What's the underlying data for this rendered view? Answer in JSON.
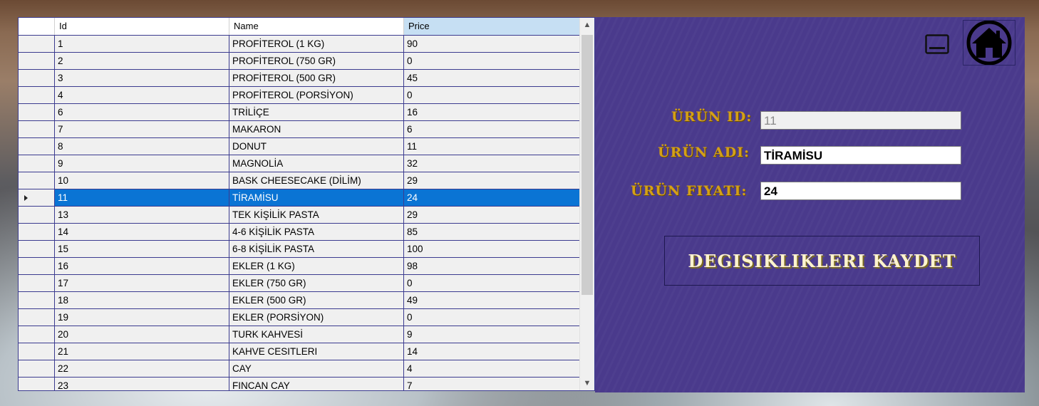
{
  "grid": {
    "columns": [
      "Id",
      "Name",
      "Price"
    ],
    "selected_id": "11",
    "rows": [
      {
        "id": "1",
        "name": "PROFİTEROL (1 KG)",
        "price": "90"
      },
      {
        "id": "2",
        "name": "PROFİTEROL (750 GR)",
        "price": "0"
      },
      {
        "id": "3",
        "name": "PROFİTEROL (500 GR)",
        "price": "45"
      },
      {
        "id": "4",
        "name": "PROFİTEROL (PORSİYON)",
        "price": "0"
      },
      {
        "id": "6",
        "name": "TRİLİÇE",
        "price": "16"
      },
      {
        "id": "7",
        "name": "MAKARON",
        "price": "6"
      },
      {
        "id": "8",
        "name": "DONUT",
        "price": "11"
      },
      {
        "id": "9",
        "name": "MAGNOLİA",
        "price": "32"
      },
      {
        "id": "10",
        "name": "BASK CHEESECAKE (DİLİM)",
        "price": "29"
      },
      {
        "id": "11",
        "name": "TİRAMİSU",
        "price": "24"
      },
      {
        "id": "13",
        "name": "TEK KİŞİLİK PASTA",
        "price": "29"
      },
      {
        "id": "14",
        "name": "4-6 KİŞİLİK PASTA",
        "price": "85"
      },
      {
        "id": "15",
        "name": "6-8 KİŞİLİK PASTA",
        "price": "100"
      },
      {
        "id": "16",
        "name": "EKLER (1 KG)",
        "price": "98"
      },
      {
        "id": "17",
        "name": "EKLER (750 GR)",
        "price": "0"
      },
      {
        "id": "18",
        "name": "EKLER (500 GR)",
        "price": "49"
      },
      {
        "id": "19",
        "name": "EKLER (PORSİYON)",
        "price": "0"
      },
      {
        "id": "20",
        "name": "TURK KAHVESİ",
        "price": "9"
      },
      {
        "id": "21",
        "name": "KAHVE CESITLERI",
        "price": "14"
      },
      {
        "id": "22",
        "name": "CAY",
        "price": "4"
      },
      {
        "id": "23",
        "name": "FINCAN CAY",
        "price": "7"
      }
    ]
  },
  "form": {
    "id_label": "ÜRÜN ID:",
    "id_value": "11",
    "name_label": "ÜRÜN ADI:",
    "name_value": "TİRAMİSU",
    "price_label": "ÜRÜN FIYATI:",
    "price_value": "24",
    "save_label": "DEGISIKLIKLERI KAYDET"
  },
  "icons": {
    "minimize": "minimize-window-icon",
    "home": "home-icon"
  },
  "colors": {
    "panel_bg": "#4a3a8c",
    "label_gold": "#d4a017",
    "selection": "#0a74d4",
    "button_text": "#fff4cf"
  }
}
